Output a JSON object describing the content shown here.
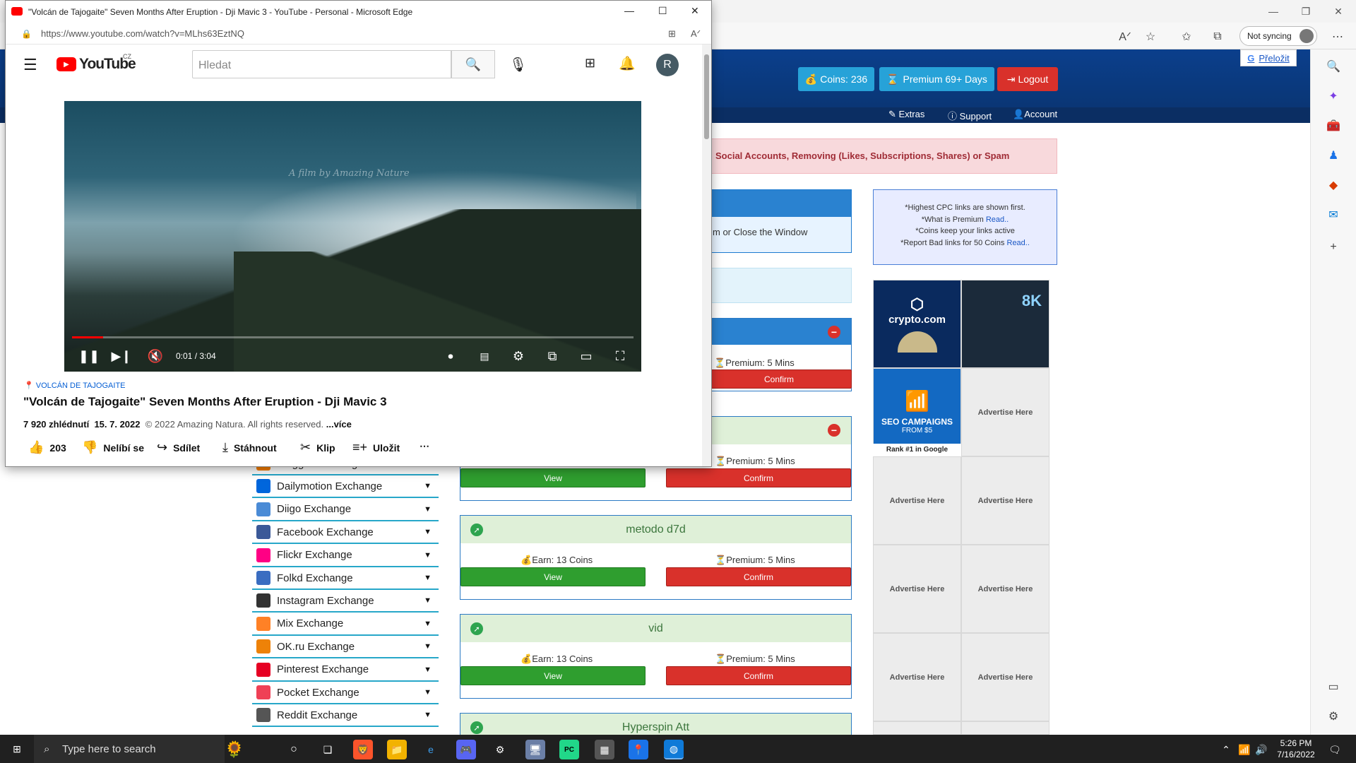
{
  "edge": {
    "sync_label": "Not syncing",
    "translate_label": "Přeložit"
  },
  "site": {
    "coins_label": "Coins: 236",
    "premium_label": "Premium 69+ Days",
    "logout_label": "Logout",
    "nav": [
      "Extras",
      "Support",
      "Account"
    ],
    "alert_text": "Social Accounts, Removing (Likes, Subscriptions, Shares) or Spam",
    "close_window_text": "m or Close the Window",
    "info_lines": [
      {
        "text": "*Highest CPC links are shown first.",
        "link": ""
      },
      {
        "text": "*What is Premium ",
        "link": "Read.."
      },
      {
        "text": "*Coins keep your links active",
        "link": ""
      },
      {
        "text": "*Report Bad links for 50 Coins ",
        "link": "Read.."
      }
    ],
    "partial_cards": [
      {
        "premium": "Premium: 5 Mins",
        "confirm": "Confirm"
      },
      {
        "premium": "Premium: 5 Mins",
        "view": "View",
        "confirm": "Confirm"
      }
    ],
    "cards": [
      {
        "title": "metodo d7d",
        "earn": "Earn: 13 Coins",
        "premium": "Premium: 5 Mins",
        "view": "View",
        "confirm": "Confirm"
      },
      {
        "title": "vid",
        "earn": "Earn: 13 Coins",
        "premium": "Premium: 5 Mins",
        "view": "View",
        "confirm": "Confirm"
      },
      {
        "title": "Hyperspin Att"
      }
    ],
    "ads": {
      "crypto_label": "crypto.com",
      "eightk_label": "8K",
      "seo_title": "SEO CAMPAIGNS",
      "seo_sub": "FROM $5",
      "seo_rank": "Rank #1 in Google",
      "advertise_label": "Advertise Here"
    },
    "menu": [
      {
        "label": "Blogger Exchange",
        "color": "#f57d00"
      },
      {
        "label": "Dailymotion Exchange",
        "color": "#0066dc"
      },
      {
        "label": "Diigo Exchange",
        "color": "#4a8bd6"
      },
      {
        "label": "Facebook Exchange",
        "color": "#3b5998"
      },
      {
        "label": "Flickr Exchange",
        "color": "#ff0084"
      },
      {
        "label": "Folkd Exchange",
        "color": "#3a6dc1"
      },
      {
        "label": "Instagram Exchange",
        "color": "#333333"
      },
      {
        "label": "Mix Exchange",
        "color": "#ff8126"
      },
      {
        "label": "OK.ru Exchange",
        "color": "#ee8208"
      },
      {
        "label": "Pinterest Exchange",
        "color": "#e60023"
      },
      {
        "label": "Pocket Exchange",
        "color": "#ef4056"
      },
      {
        "label": "Reddit Exchange",
        "color": "#555555"
      }
    ]
  },
  "youtube": {
    "window_title": "\"Volcán de Tajogaite\" Seven Months After Eruption - Dji Mavic 3 - YouTube - Personal - Microsoft Edge",
    "url": "https://www.youtube.com/watch?v=MLhs63EztNQ",
    "logo_text": "YouTube",
    "region": "CZ",
    "search_placeholder": "Hledat",
    "avatar_letter": "R",
    "watermark": "A film by Amazing Nature",
    "time": "0:01 / 3:04",
    "progress": 0.006,
    "location": "VOLCÁN DE TAJOGAITE",
    "title": "\"Volcán de Tajogaite\" Seven Months After Eruption - Dji Mavic 3",
    "views": "7 920 zhlédnutí",
    "date": "15. 7. 2022",
    "desc": "© 2022 Amazing Natura. All rights reserved.",
    "more": "...více",
    "actions": {
      "likes": "203",
      "dislike": "Nelíbí se",
      "share": "Sdílet",
      "download": "Stáhnout",
      "clip": "Klip",
      "save": "Uložit"
    }
  },
  "taskbar": {
    "search_placeholder": "Type here to search",
    "time": "5:26 PM",
    "date": "7/16/2022"
  }
}
